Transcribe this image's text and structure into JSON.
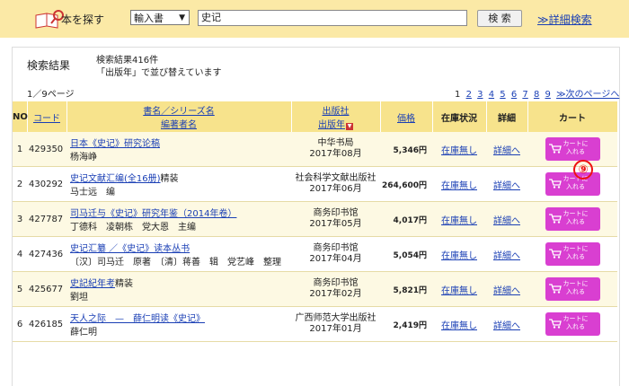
{
  "header": {
    "search_label": "本を探す",
    "category_selected": "輸入書",
    "search_value": "史记",
    "search_button": "検 索",
    "advanced_search": "≫詳細検索"
  },
  "results": {
    "title": "検索結果",
    "count": "検索結果416件",
    "sort_note": "「出版年」で並び替えています",
    "page_info": "1／9ページ",
    "pager": {
      "current": "1",
      "pages": [
        "2",
        "3",
        "4",
        "5",
        "6",
        "7",
        "8",
        "9"
      ],
      "next": "≫次のページへ"
    }
  },
  "table": {
    "headers": {
      "no": "NO",
      "code": "コード",
      "title": "書名／シリーズ名",
      "author": "編著者名",
      "publisher": "出版社",
      "year": "出版年",
      "price": "価格",
      "stock": "在庫状況",
      "detail": "詳細",
      "cart": "カート"
    },
    "rows": [
      {
        "no": "1",
        "code": "429350",
        "title": "日本《史记》研究论稿",
        "title_suffix": "",
        "author": "杨海峥",
        "publisher": "中华书局",
        "year": "2017年08月",
        "price": "5,346円",
        "stock": "在庫無し",
        "detail": "詳細へ",
        "cart": "カートに入れる"
      },
      {
        "no": "2",
        "code": "430292",
        "title": "史记文献汇编(全16册)",
        "title_suffix": "精装",
        "author": "马士远　编",
        "publisher": "社会科学文献出版社",
        "year": "2017年06月",
        "price": "264,600円",
        "stock": "在庫無し",
        "detail": "詳細へ",
        "cart": "カートに入れる"
      },
      {
        "no": "3",
        "code": "427787",
        "title": "司马迁与《史记》研究年鉴（2014年卷）",
        "title_suffix": "",
        "author": "丁德科　凌朝栋　党大恩　主编",
        "publisher": "商务印书馆",
        "year": "2017年05月",
        "price": "4,017円",
        "stock": "在庫無し",
        "detail": "詳細へ",
        "cart": "カートに入れる"
      },
      {
        "no": "4",
        "code": "427436",
        "title": "史记汇纂 ／《史记》读本丛书",
        "title_suffix": "",
        "author": "〔汉〕司马迁　原著　〔清〕蒋善　辑　党艺峰　整理",
        "publisher": "商务印书馆",
        "year": "2017年04月",
        "price": "5,054円",
        "stock": "在庫無し",
        "detail": "詳細へ",
        "cart": "カートに入れる"
      },
      {
        "no": "5",
        "code": "425677",
        "title": "史記紀年考",
        "title_suffix": "精装",
        "author": "劉坦",
        "publisher": "商务印书馆",
        "year": "2017年02月",
        "price": "5,821円",
        "stock": "在庫無し",
        "detail": "詳細へ",
        "cart": "カートに入れる"
      },
      {
        "no": "6",
        "code": "426185",
        "title": "天人之际　—　薛仁明读《史记》",
        "title_suffix": "",
        "author": "薛仁明",
        "publisher": "广西师范大学出版社",
        "year": "2017年01月",
        "price": "2,419円",
        "stock": "在庫無し",
        "detail": "詳細へ",
        "cart": "カートに入れる"
      }
    ]
  },
  "annotation": "⑨",
  "colors": {
    "topbar": "#fbe9a6",
    "header_row": "#f7e38c",
    "row_tint": "#fdf9e3",
    "link": "#1a3fb5",
    "cart_button": "#d93fd1",
    "annotation": "#ee1111"
  },
  "icons": {
    "logo": "book-magnifier-icon",
    "cart": "cart-icon",
    "sort": "sort-down-icon"
  }
}
